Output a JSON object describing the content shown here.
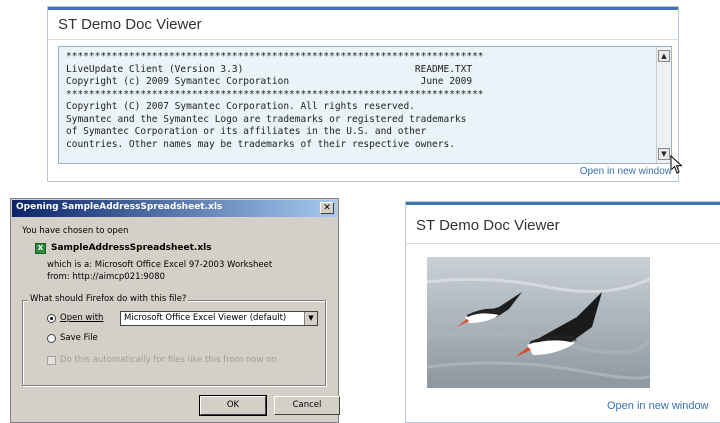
{
  "viewer_top": {
    "title": "ST Demo Doc Viewer",
    "readme_lines": [
      "*************************************************************************",
      "LiveUpdate Client (Version 3.3)                              README.TXT",
      "Copyright (c) 2009 Symantec Corporation                       June 2009",
      "*************************************************************************",
      "Copyright (C) 2007 Symantec Corporation. All rights reserved.",
      "Symantec and the Symantec Logo are trademarks or registered trademarks",
      "of Symantec Corporation or its affiliates in the U.S. and other",
      "countries. Other names may be trademarks of their respective owners."
    ],
    "open_link": "Open in new window"
  },
  "dialog": {
    "title": "Opening SampleAddressSpreadsheet.xls",
    "close_glyph": "✕",
    "chosen_text": "You have chosen to open",
    "file_name": "SampleAddressSpreadsheet.xls",
    "which_is": "which is a:  Microsoft Office Excel 97-2003 Worksheet",
    "from": "from:  http://aimcp021:9080",
    "group_label": "What should Firefox do with this file?",
    "open_with_label": "Open with",
    "open_with_value": "Microsoft Office Excel Viewer (default)",
    "save_file_label": "Save File",
    "auto_label": "Do this automatically for files like this from now on.",
    "ok_label": "OK",
    "cancel_label": "Cancel"
  },
  "viewer_bottom": {
    "title": "ST Demo Doc Viewer",
    "open_link": "Open in new window"
  },
  "colors": {
    "accent_blue": "#3f72b5",
    "link": "#3a6fb0",
    "doc_bg": "#e9f3f8",
    "dialog_bg": "#d4d0c8",
    "titlebar": "#0a246a"
  }
}
